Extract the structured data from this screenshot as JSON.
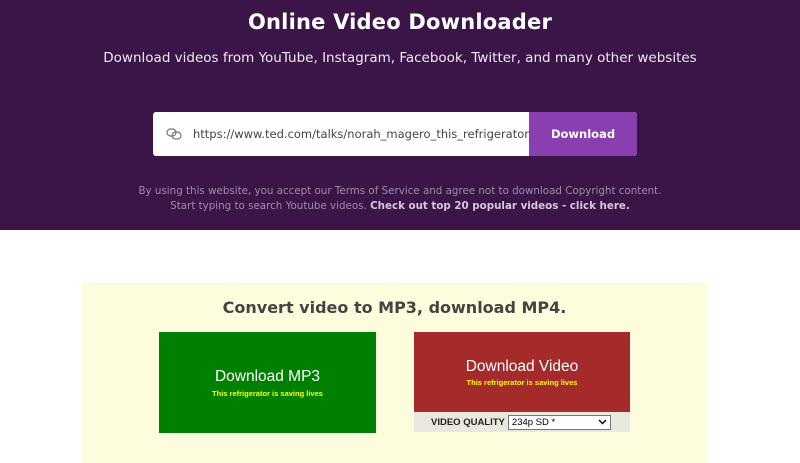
{
  "header": {
    "title": "Online Video Downloader",
    "subtitle": "Download videos from YouTube, Instagram, Facebook, Twitter, and many other websites",
    "background_color": "#3b1547",
    "accent_color": "#8a3fb0"
  },
  "search": {
    "url_value": "https://www.ted.com/talks/norah_magero_this_refrigerator_is_sa",
    "button_label": "Download",
    "icon": "link-icon"
  },
  "disclaimer": {
    "line1": "By using this website, you accept our Terms of Service and agree not to download Copyright content.",
    "line2_text": "Start typing to search Youtube videos.",
    "line2_link": "Check out top 20 popular videos - click here."
  },
  "convert": {
    "title": "Convert video to MP3, download MP4.",
    "mp3": {
      "label": "Download MP3",
      "subtitle": "This refrigerator is saving lives",
      "color": "#008000"
    },
    "video": {
      "label": "Download Video",
      "subtitle": "This refrigerator is saving lives",
      "color": "#a52a2a"
    },
    "quality": {
      "label": "VIDEO QUALITY",
      "selected": "234p SD *"
    }
  }
}
